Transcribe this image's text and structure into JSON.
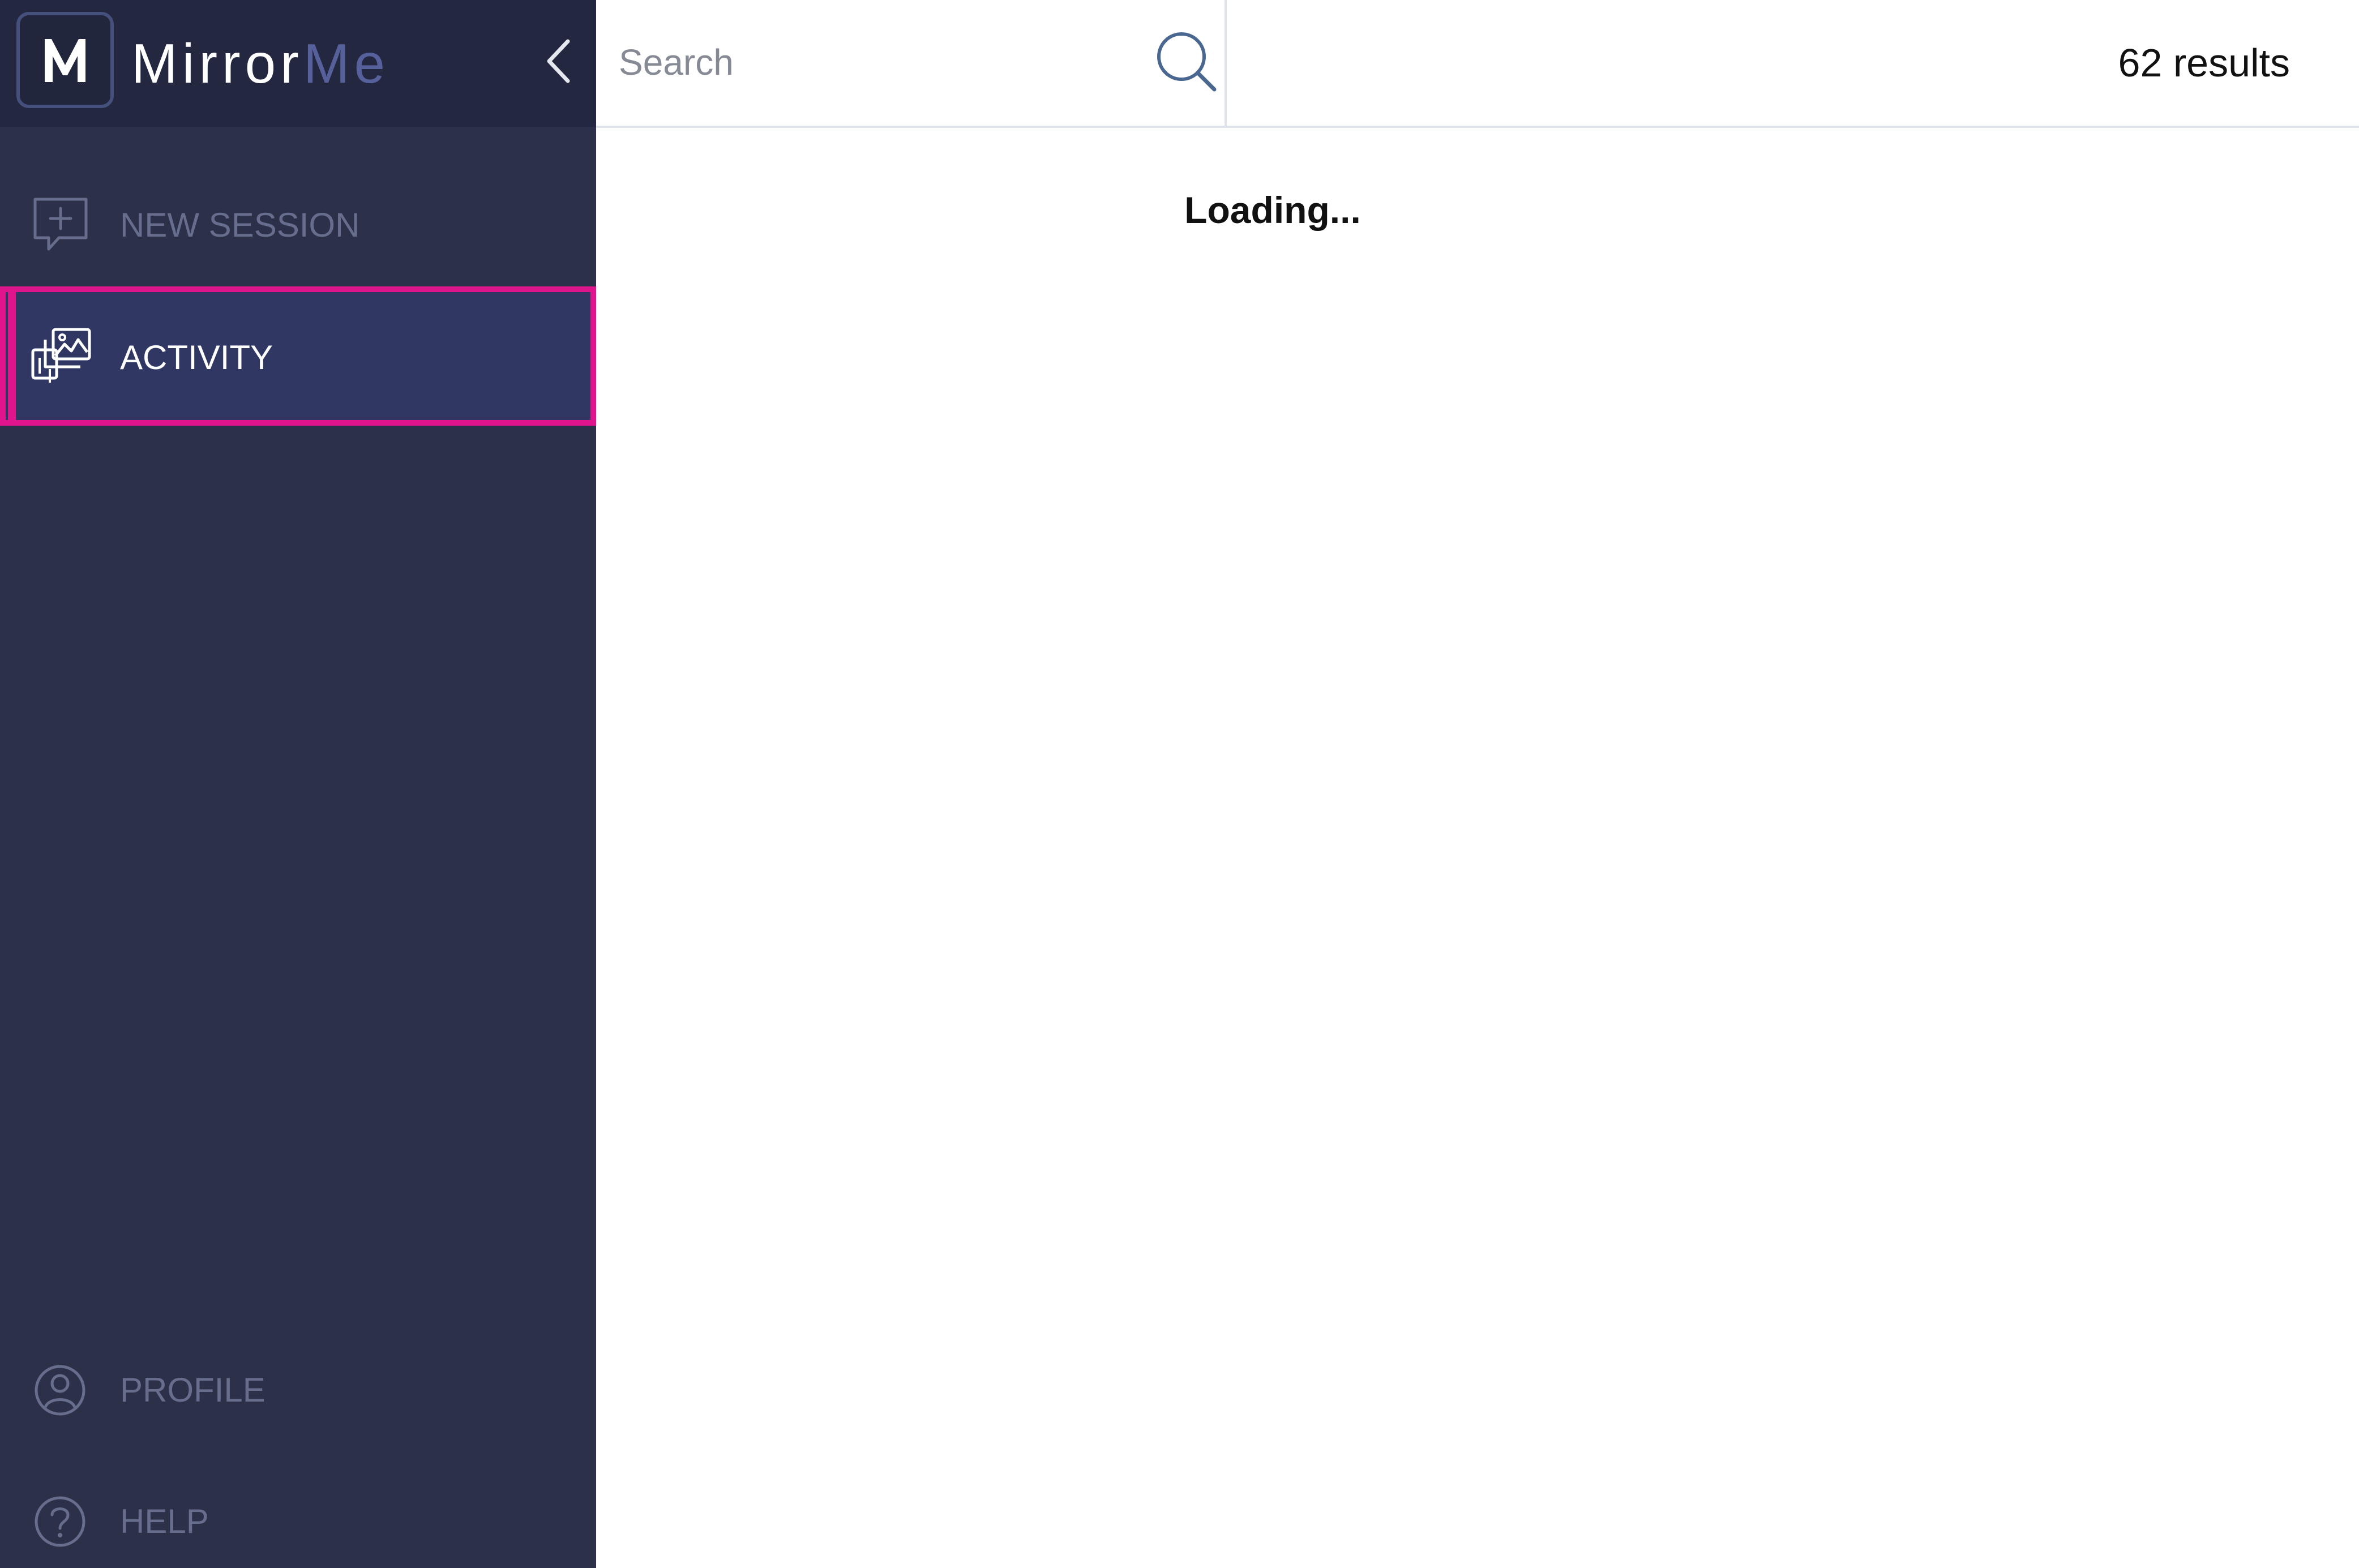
{
  "brand": {
    "logo_letter": "M",
    "name_part1": "Mirror",
    "name_part2": "Me"
  },
  "sidebar": {
    "collapse_icon": "chevron-left-icon",
    "items": [
      {
        "label": "NEW SESSION",
        "icon": "chat-plus-icon",
        "active": false
      },
      {
        "label": "ACTIVITY",
        "icon": "gallery-icon",
        "active": true
      }
    ],
    "bottom_items": [
      {
        "label": "PROFILE",
        "icon": "user-circle-icon"
      },
      {
        "label": "HELP",
        "icon": "help-circle-icon"
      }
    ]
  },
  "search": {
    "placeholder": "Search",
    "value": "",
    "icon": "search-icon"
  },
  "results": {
    "count_text": "62 results"
  },
  "main": {
    "loading_text": "Loading..."
  },
  "colors": {
    "sidebar_bg": "#2c3049",
    "header_bg": "#232740",
    "active_bg": "#2f3762",
    "accent": "#e0148c",
    "brand_secondary": "#56609b",
    "muted_text": "#676d8c"
  }
}
